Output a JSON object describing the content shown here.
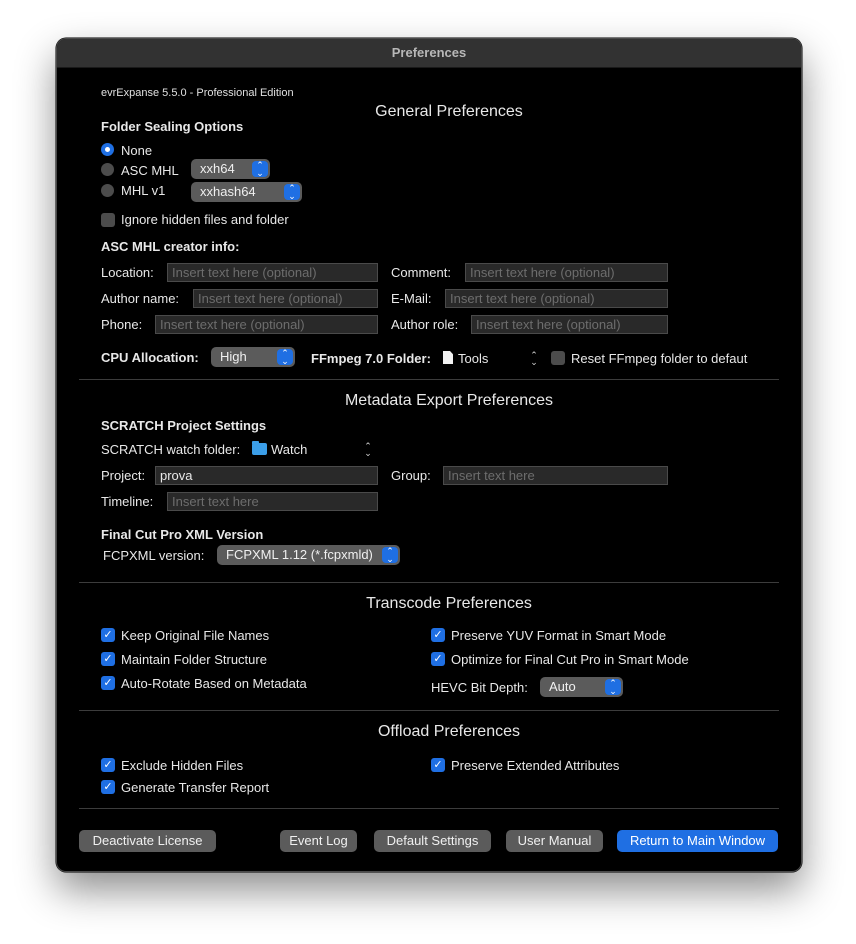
{
  "window": {
    "title": "Preferences"
  },
  "app": {
    "version": "evrExpanse 5.5.0 - Professional Edition"
  },
  "general": {
    "title": "General Preferences",
    "folder_sealing": {
      "label": "Folder Sealing Options",
      "none_label": "None",
      "asc_mhl_label": "ASC MHL",
      "asc_mhl_hash": "xxh64",
      "mhl_v1_label": "MHL v1",
      "mhl_v1_hash": "xxhash64",
      "selected": "None"
    },
    "ignore_hidden_label": "Ignore hidden files and folder",
    "ignore_hidden_checked": false,
    "creator_info": {
      "label": "ASC MHL creator info:",
      "location_label": "Location:",
      "comment_label": "Comment:",
      "author_name_label": "Author name:",
      "email_label": "E-Mail:",
      "phone_label": "Phone:",
      "author_role_label": "Author role:",
      "placeholder": "Insert text here (optional)"
    },
    "cpu_label": "CPU Allocation:",
    "cpu_value": "High",
    "ffmpeg_label": "FFmpeg 7.0 Folder:",
    "ffmpeg_folder": "Tools",
    "reset_ffmpeg_label": "Reset FFmpeg folder to defaut",
    "reset_ffmpeg_checked": false
  },
  "metadata": {
    "title": "Metadata Export Preferences",
    "scratch_label": "SCRATCH Project Settings",
    "watch_folder_label": "SCRATCH watch folder:",
    "watch_folder_value": "Watch",
    "project_label": "Project:",
    "project_value": "prova",
    "group_label": "Group:",
    "group_placeholder": "Insert text here",
    "timeline_label": "Timeline:",
    "timeline_placeholder": "Insert text here",
    "fcp_label": "Final Cut Pro XML Version",
    "fcpxml_version_label": "FCPXML version:",
    "fcpxml_version_value": "FCPXML 1.12 (*.fcpxmld)"
  },
  "transcode": {
    "title": "Transcode Preferences",
    "keep_names": "Keep Original File Names",
    "maintain_structure": "Maintain Folder Structure",
    "auto_rotate": "Auto-Rotate Based on Metadata",
    "preserve_yuv": "Preserve YUV Format in Smart Mode",
    "optimize_fcp": "Optimize for Final Cut Pro in Smart Mode",
    "hevc_label": "HEVC Bit Depth:",
    "hevc_value": "Auto"
  },
  "offload": {
    "title": "Offload Preferences",
    "exclude_hidden": "Exclude Hidden Files",
    "generate_report": "Generate Transfer Report",
    "preserve_attrs": "Preserve Extended Attributes"
  },
  "footer": {
    "deactivate": "Deactivate License",
    "event_log": "Event Log",
    "default_settings": "Default Settings",
    "user_manual": "User Manual",
    "return_main": "Return to Main Window"
  },
  "colors": {
    "accent": "#1f6fe3",
    "background": "#000000",
    "control": "#5b5b5b"
  },
  "icons": {
    "check": "checkmark-icon",
    "popup": "updown-chevron-icon",
    "folder": "folder-icon",
    "document": "document-icon"
  }
}
